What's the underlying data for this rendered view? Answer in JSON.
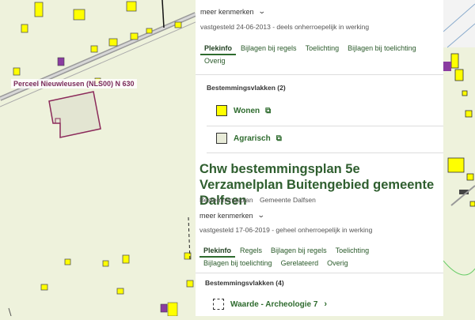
{
  "map": {
    "parcel_label": "Perceel Nieuwleusen (NLS00) N 630",
    "map_colors": {
      "background": "#eef2dc",
      "residential": "#ffff00",
      "agricultural": "#e8ebd8",
      "parcel_border": "#8b2a5a"
    }
  },
  "plan1": {
    "meer_label": "meer kenmerken",
    "status": "vastgesteld 24-06-2013 - deels onherroepelijk in werking",
    "tabs": [
      "Plekinfo",
      "Bijlagen bij regels",
      "Toelichting",
      "Bijlagen bij toelichting",
      "Overig"
    ],
    "section_title": "Bestemmingsvlakken (2)",
    "vlakken": [
      {
        "label": "Wonen",
        "color": "#ffff00"
      },
      {
        "label": "Agrarisch",
        "color": "#e8ebd8"
      }
    ]
  },
  "plan2": {
    "title": "Chw bestemmingsplan 5e Verzamelplan Buitengebied gemeente Dalfsen",
    "type": "Bestemmingsplan",
    "gemeente": "Gemeente Dalfsen",
    "meer_label": "meer kenmerken",
    "status": "vastgesteld 17-06-2019 - geheel onherroepelijk in werking",
    "tabs": [
      "Plekinfo",
      "Regels",
      "Bijlagen bij regels",
      "Toelichting",
      "Bijlagen bij toelichting",
      "Gerelateerd",
      "Overig"
    ],
    "section_title": "Bestemmingsvlakken (4)",
    "vlakken": [
      {
        "label": "Waarde - Archeologie 7"
      }
    ]
  },
  "icons": {
    "external": "external-link-icon",
    "chevron_down": "chevron-down-icon",
    "chevron_right": "chevron-right-icon"
  }
}
